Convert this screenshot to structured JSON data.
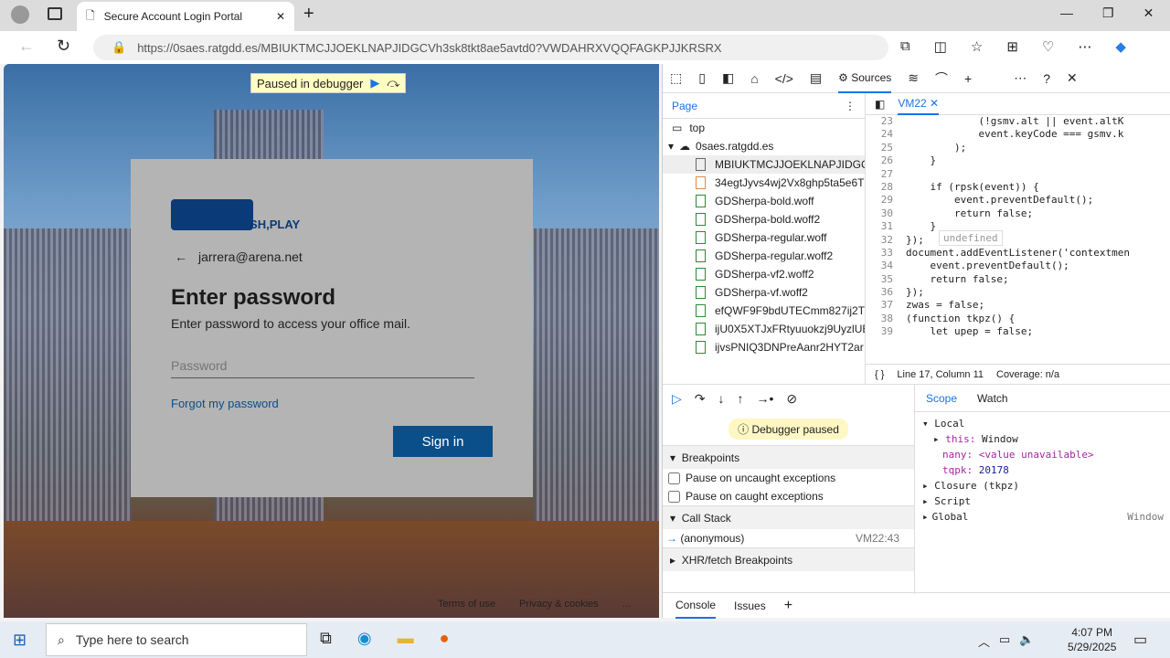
{
  "browser": {
    "tab_title": "Secure Account Login Portal",
    "url": "https://0saes.ratgdd.es/MBIUKTMCJJOEKLNAPJIDGCVh3sk8tkt8ae5avtd0?VWDAHRXVQQFAGKPJJKRSRX"
  },
  "page": {
    "debugger_banner": "Paused in debugger",
    "logo_text": "PUSH,PLAY",
    "email": "jarrera@arena.net",
    "heading": "Enter password",
    "subheading": "Enter password to access your office mail.",
    "password_placeholder": "Password",
    "forgot": "Forgot my password",
    "sign_in": "Sign in",
    "footer": [
      "Terms of use",
      "Privacy & cookies",
      "..."
    ],
    "accent": "#0a4e8a"
  },
  "devtools": {
    "active_tab": "Sources",
    "nav_tab": "Page",
    "file_tab": "VM22",
    "tree": {
      "top": "top",
      "domain": "0saes.ratgdd.es",
      "files": [
        "MBIUKTMCJJOEKLNAPJIDGCV",
        "34egtJyvs4wj2Vx8ghp5ta5e6T",
        "GDSherpa-bold.woff",
        "GDSherpa-bold.woff2",
        "GDSherpa-regular.woff",
        "GDSherpa-regular.woff2",
        "GDSherpa-vf2.woff2",
        "GDSherpa-vf.woff2",
        "efQWF9F9bdUTECmm827ij2T",
        "ijU0X5XTJxFRtyuuokzj9UyzlUE",
        "ijvsPNIQ3DNPreAanr2HYT2ar"
      ]
    },
    "code": [
      {
        "n": "23",
        "t": "            (!gsmv.alt || event.altK"
      },
      {
        "n": "24",
        "t": "            event.keyCode === gsmv.k"
      },
      {
        "n": "25",
        "t": "        );"
      },
      {
        "n": "26",
        "t": "    }"
      },
      {
        "n": "27",
        "t": ""
      },
      {
        "n": "28",
        "t": "    if (rpsk(event)) {"
      },
      {
        "n": "29",
        "t": "        event.preventDefault();"
      },
      {
        "n": "30",
        "t": "        return false;"
      },
      {
        "n": "31",
        "t": "    }"
      },
      {
        "n": "32",
        "t": "});"
      },
      {
        "n": "33",
        "t": "document.addEventListener('contextmen"
      },
      {
        "n": "34",
        "t": "    event.preventDefault();"
      },
      {
        "n": "35",
        "t": "    return false;"
      },
      {
        "n": "36",
        "t": "});"
      },
      {
        "n": "37",
        "t": "zwas = false;"
      },
      {
        "n": "38",
        "t": "(function tkpz() {"
      },
      {
        "n": "39",
        "t": "    let upep = false;"
      }
    ],
    "tooltip": "undefined",
    "status": {
      "position": "Line 17, Column 11",
      "coverage": "Coverage: n/a"
    },
    "paused": "Debugger paused",
    "breakpoints": "Breakpoints",
    "pause_uncaught": "Pause on uncaught exceptions",
    "pause_caught": "Pause on caught exceptions",
    "call_stack": "Call Stack",
    "frame": "(anonymous)",
    "frame_loc": "VM22:43",
    "xhr": "XHR/fetch Breakpoints",
    "scope_tab": "Scope",
    "watch_tab": "Watch",
    "scope": {
      "local": "Local",
      "this_k": "this:",
      "this_v": "Window",
      "nany_k": "nany:",
      "nany_v": "<value unavailable>",
      "tqpk_k": "tqpk:",
      "tqpk_v": "20178",
      "closure": "Closure (tkpz)",
      "script": "Script",
      "global": "Global",
      "global_v": "Window"
    },
    "drawer": [
      "Console",
      "Issues"
    ]
  },
  "taskbar": {
    "search": "Type here to search",
    "time": "4:07 PM",
    "date": "5/29/2025"
  }
}
